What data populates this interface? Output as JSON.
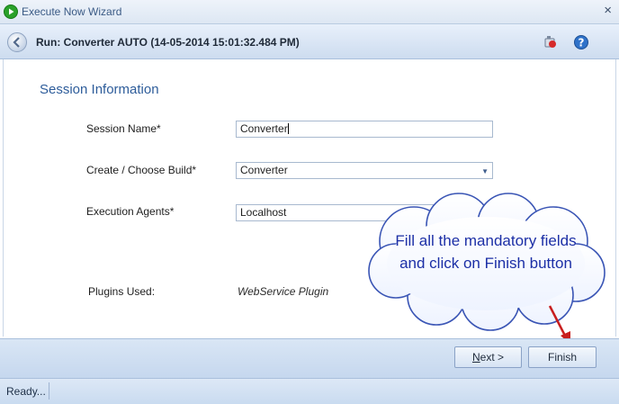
{
  "window": {
    "title": "Execute Now Wizard",
    "close_glyph": "×"
  },
  "header": {
    "run_title": "Run: Converter AUTO (14-05-2014 15:01:32.484 PM)",
    "icons": [
      "record-icon",
      "help-icon"
    ]
  },
  "section": {
    "title": "Session Information"
  },
  "fields": {
    "session_name": {
      "label": "Session Name*",
      "value": "Converter"
    },
    "build": {
      "label": "Create / Choose Build*",
      "value": "Converter"
    },
    "agents": {
      "label": "Execution Agents*",
      "value": "Localhost"
    },
    "plugins": {
      "label": "Plugins Used:",
      "value": "WebService Plugin"
    }
  },
  "callout": {
    "text": "Fill all the mandatory fields and click on Finish button"
  },
  "buttons": {
    "next_underlined": "N",
    "next_rest": "ext >",
    "finish": "Finish"
  },
  "status": {
    "text": "Ready..."
  },
  "colors": {
    "section_title": "#2d5c9a",
    "callout_text": "#1c2fa6",
    "arrow": "#c81e1e"
  }
}
